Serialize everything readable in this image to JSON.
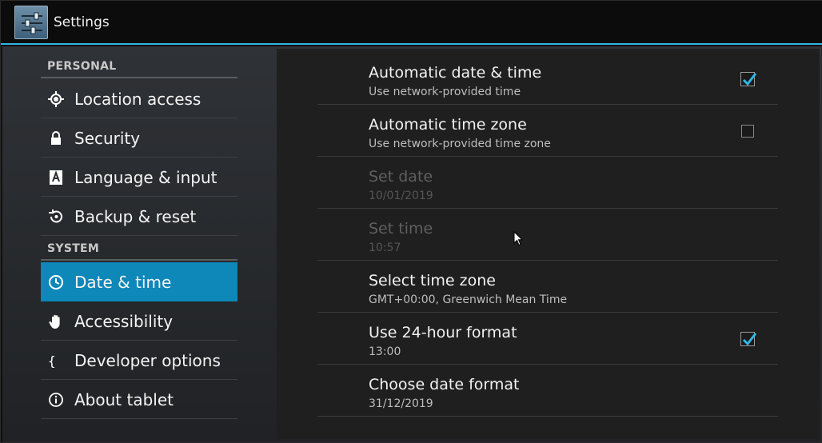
{
  "app": {
    "title": "Settings"
  },
  "sidebar": {
    "sections": [
      {
        "header": "PERSONAL"
      },
      {
        "header": "SYSTEM"
      }
    ],
    "items": [
      {
        "label": "Location access",
        "icon": "location-target-icon"
      },
      {
        "label": "Security",
        "icon": "lock-icon"
      },
      {
        "label": "Language & input",
        "icon": "keyboard-a-icon"
      },
      {
        "label": "Backup & reset",
        "icon": "restore-icon"
      },
      {
        "label": "Date & time",
        "icon": "clock-icon",
        "selected": true
      },
      {
        "label": "Accessibility",
        "icon": "hand-icon"
      },
      {
        "label": "Developer options",
        "icon": "braces-icon"
      },
      {
        "label": "About tablet",
        "icon": "info-icon"
      }
    ]
  },
  "prefs": [
    {
      "title": "Automatic date & time",
      "summary": "Use network-provided time",
      "checkbox": true,
      "checked": true,
      "enabled": true
    },
    {
      "title": "Automatic time zone",
      "summary": "Use network-provided time zone",
      "checkbox": true,
      "checked": false,
      "enabled": true
    },
    {
      "title": "Set date",
      "summary": "10/01/2019",
      "checkbox": false,
      "enabled": false
    },
    {
      "title": "Set time",
      "summary": "10:57",
      "checkbox": false,
      "enabled": false
    },
    {
      "title": "Select time zone",
      "summary": "GMT+00:00, Greenwich Mean Time",
      "checkbox": false,
      "enabled": true
    },
    {
      "title": "Use 24-hour format",
      "summary": "13:00",
      "checkbox": true,
      "checked": true,
      "enabled": true
    },
    {
      "title": "Choose date format",
      "summary": "31/12/2019",
      "checkbox": false,
      "enabled": true
    }
  ],
  "colors": {
    "accent": "#33b5e5",
    "selected_bg": "#0e87b9",
    "check": "#33b5e5"
  }
}
